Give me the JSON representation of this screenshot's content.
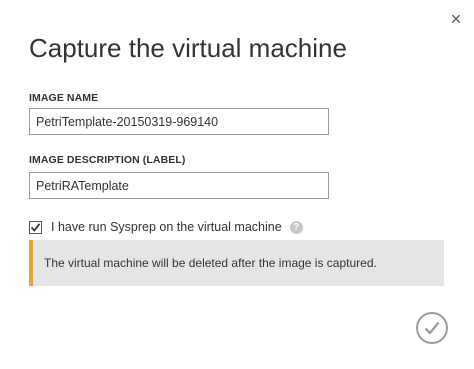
{
  "dialog": {
    "title": "Capture the virtual machine",
    "close_glyph": "×"
  },
  "image_name": {
    "label": "IMAGE NAME",
    "value": "PetriTemplate-20150319-969140"
  },
  "image_description": {
    "label": "IMAGE DESCRIPTION (LABEL)",
    "value": "PetriRATemplate"
  },
  "sysprep": {
    "label": "I have run Sysprep on the virtual machine",
    "checked": true,
    "help_glyph": "?"
  },
  "warning": {
    "text": "The virtual machine will be deleted after the image is captured.",
    "accent_color": "#e8a13a"
  },
  "icons": {
    "close": "close-icon",
    "check": "checkmark-icon",
    "help": "help-icon",
    "ok": "complete-checkmark-icon"
  }
}
